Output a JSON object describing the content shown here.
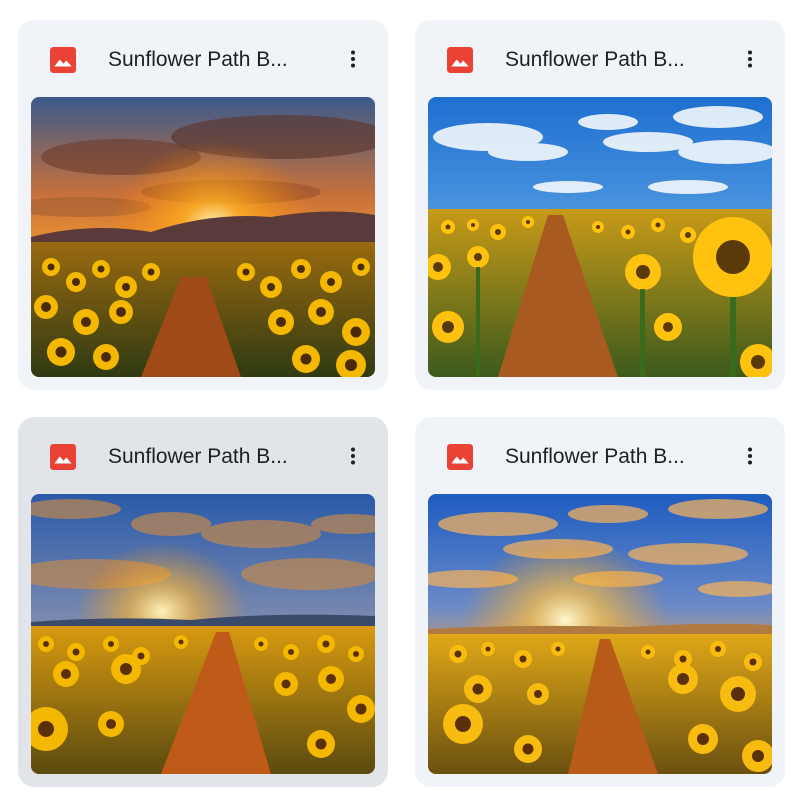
{
  "files": [
    {
      "title": "Sunflower Path B...",
      "icon": "image-file-icon",
      "menu_icon": "more-vert-icon",
      "scene": "sunset-hills"
    },
    {
      "title": "Sunflower Path B...",
      "icon": "image-file-icon",
      "menu_icon": "more-vert-icon",
      "scene": "blue-sky-day"
    },
    {
      "title": "Sunflower Path B...",
      "icon": "image-file-icon",
      "menu_icon": "more-vert-icon",
      "scene": "golden-sunset-path"
    },
    {
      "title": "Sunflower Path B...",
      "icon": "image-file-icon",
      "menu_icon": "more-vert-icon",
      "scene": "glowing-sunset-field"
    }
  ],
  "colors": {
    "card_bg": "#f0f4f9",
    "card_selected_bg": "#e1e5ea",
    "image_icon_red": "#ea4335",
    "title_text": "#1f1f1f"
  }
}
